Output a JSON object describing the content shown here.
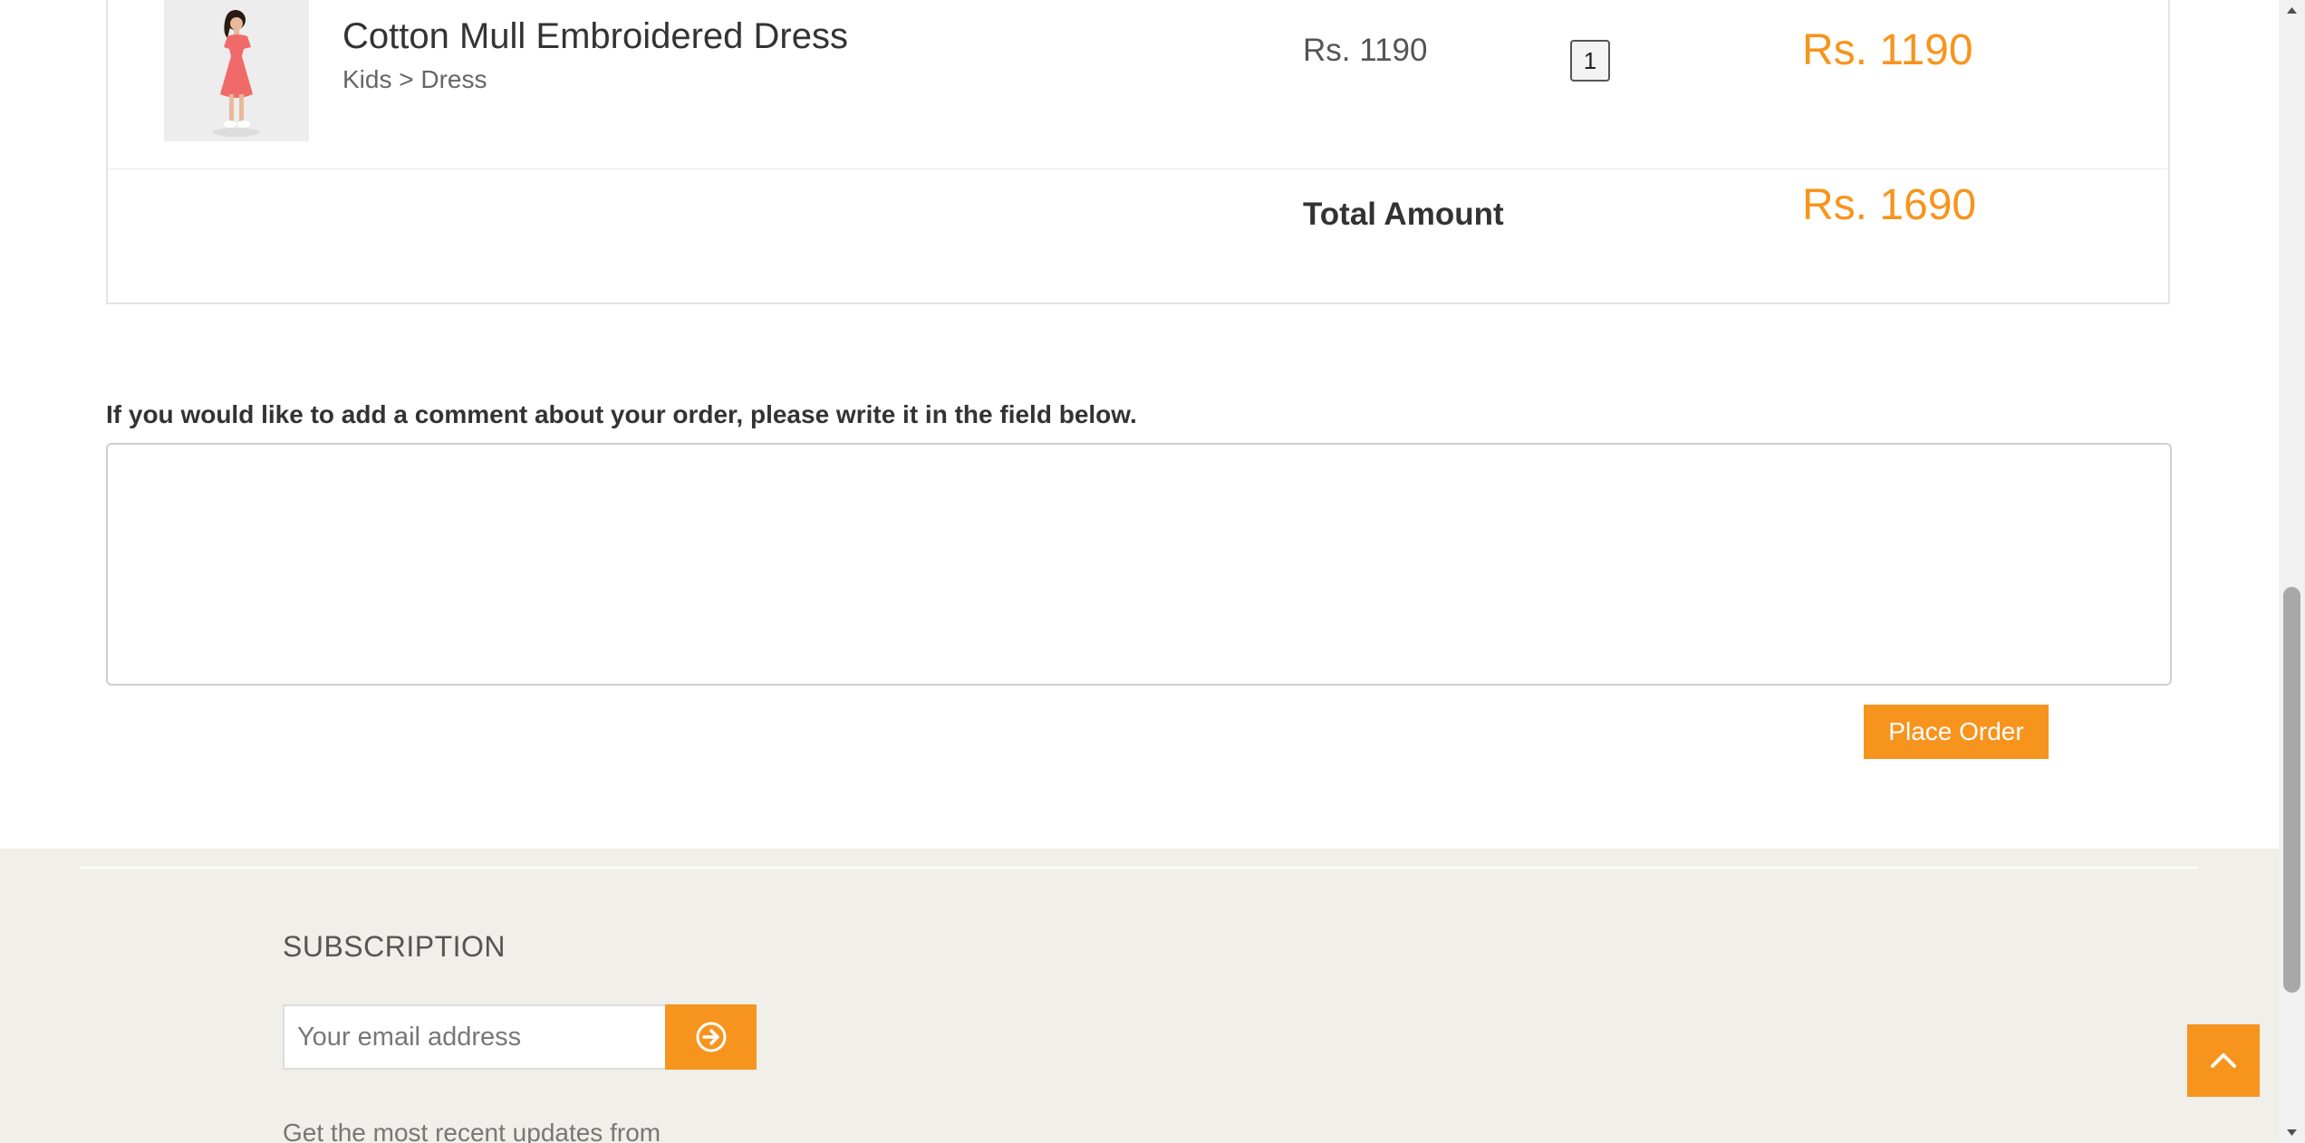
{
  "order": {
    "item": {
      "name": "Cotton Mull Embroidered Dress",
      "category": "Kids > Dress",
      "unit_price": "Rs. 1190",
      "quantity": "1",
      "line_total": "Rs. 1190"
    },
    "total_label": "Total Amount",
    "total_value": "Rs. 1690"
  },
  "comment": {
    "label": "If you would like to add a comment about your order, please write it in the field below.",
    "value": ""
  },
  "actions": {
    "place_order_label": "Place Order"
  },
  "footer": {
    "subscription_heading": "SUBSCRIPTION",
    "email_placeholder": "Your email address",
    "subscribe_icon": "arrow-circle-right-icon",
    "updates_text": "Get the most recent updates from",
    "back_to_top_icon": "chevron-up-icon"
  },
  "colors": {
    "accent": "#f7941d",
    "footer_bg": "#f0efe9",
    "text": "#333333"
  }
}
